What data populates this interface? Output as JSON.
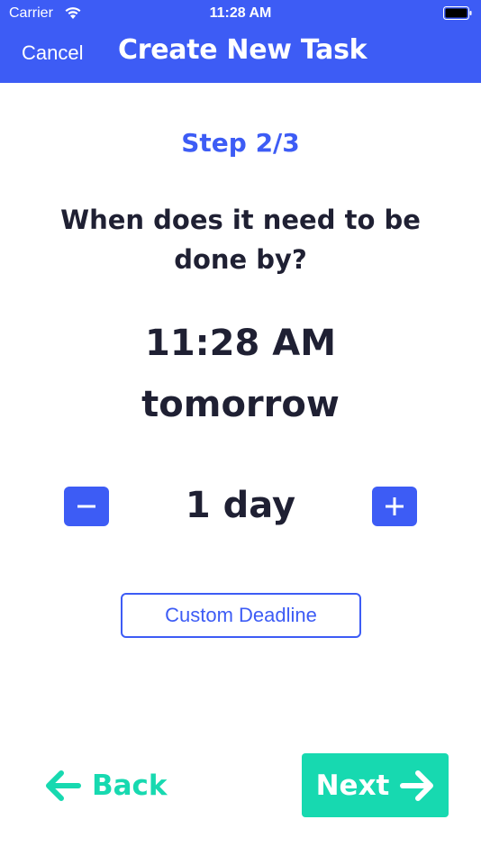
{
  "status_bar": {
    "carrier": "Carrier",
    "time": "11:28 AM",
    "wifi_icon": "wifi-icon",
    "battery_icon": "battery-icon"
  },
  "nav": {
    "cancel_label": "Cancel",
    "title": "Create New Task"
  },
  "content": {
    "step": "Step 2/3",
    "question": "When does it need to be done by?",
    "due_time": "11:28 AM",
    "due_day": "tomorrow",
    "duration": "1 day",
    "decrement_icon": "minus-icon",
    "increment_icon": "plus-icon",
    "custom_deadline_label": "Custom Deadline"
  },
  "footer": {
    "back_label": "Back",
    "back_icon": "arrow-left-icon",
    "next_label": "Next",
    "next_icon": "arrow-right-icon"
  },
  "colors": {
    "primary": "#3d5cf5",
    "accent": "#17d9b0",
    "text": "#1f2033",
    "background": "#ffffff"
  }
}
